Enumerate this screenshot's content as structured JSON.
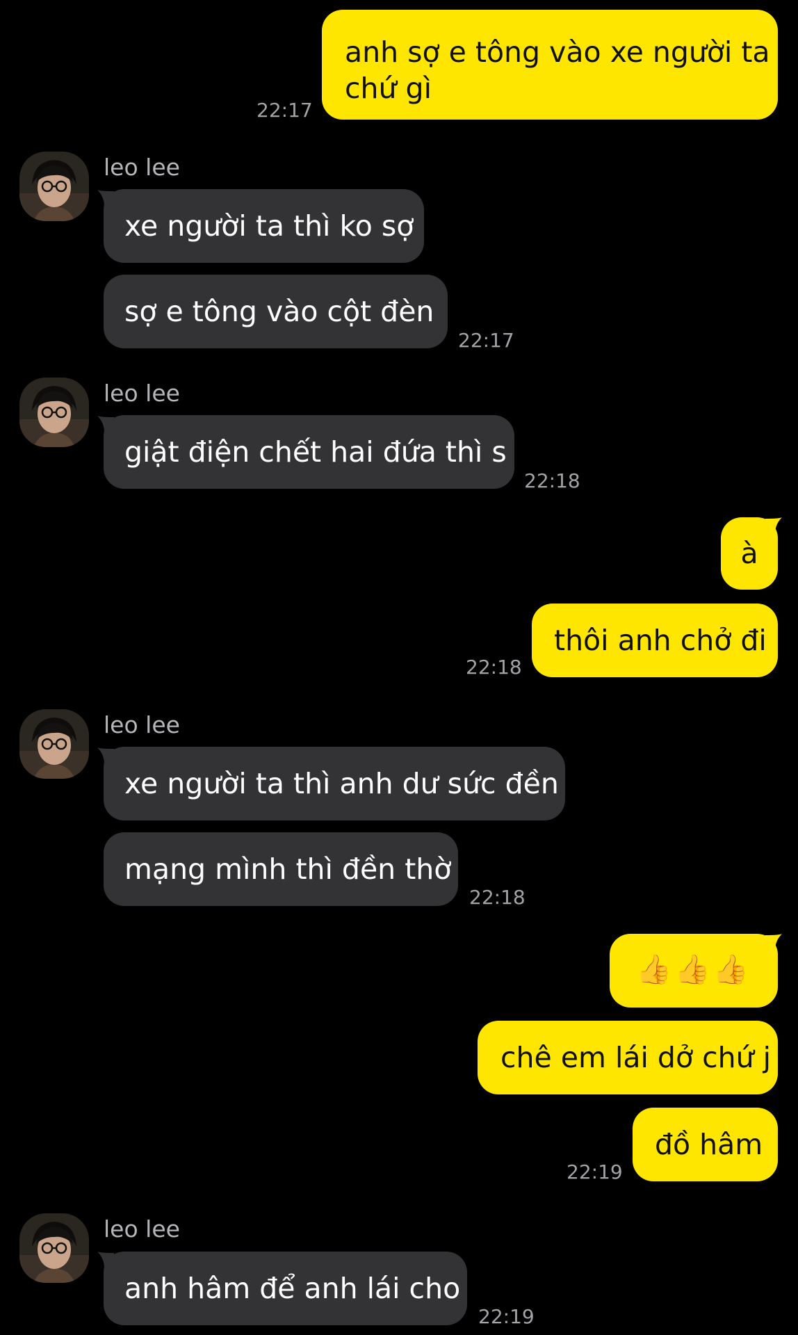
{
  "colors": {
    "background": "#000000",
    "outgoing_bubble": "#ffe600",
    "incoming_bubble": "#333335",
    "timestamp": "#a4a4a8"
  },
  "messages": [
    {
      "dir": "out",
      "lines": [
        "anh sợ e tông vào xe người ta",
        "chứ gì"
      ],
      "time": "22:17"
    },
    {
      "dir": "in",
      "sender": "leo lee",
      "text": "xe người ta thì ko sợ"
    },
    {
      "dir": "in",
      "text": "sợ e tông vào cột đèn",
      "time": "22:17"
    },
    {
      "dir": "in",
      "sender": "leo lee",
      "text": "giật điện chết hai đứa thì s",
      "time": "22:18"
    },
    {
      "dir": "out",
      "text": "à"
    },
    {
      "dir": "out",
      "text": "thôi anh chở đi",
      "time": "22:18"
    },
    {
      "dir": "in",
      "sender": "leo lee",
      "text": "xe người ta thì anh dư sức đền"
    },
    {
      "dir": "in",
      "text": "mạng mình thì đền thờ",
      "time": "22:18"
    },
    {
      "dir": "out",
      "text": "👍👍👍",
      "emoji_icon": "thumbs-up-icon"
    },
    {
      "dir": "out",
      "text": "chê em lái dở chứ j"
    },
    {
      "dir": "out",
      "text": "đồ hâm",
      "time": "22:19"
    },
    {
      "dir": "in",
      "sender": "leo lee",
      "text": "anh hâm để anh lái cho",
      "time": "22:19"
    }
  ]
}
